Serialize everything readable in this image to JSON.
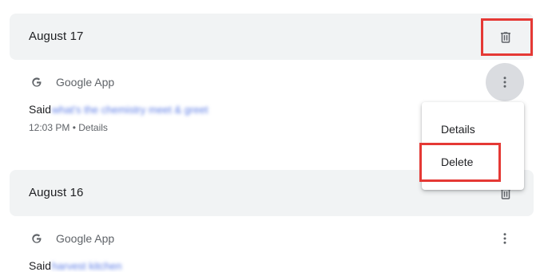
{
  "groups": [
    {
      "date": "August 17",
      "entry": {
        "app_icon": "google-g-icon",
        "app_name": "Google App",
        "said_prefix": "Said",
        "said_text_blurred": "what's the chemistry meet & greet",
        "meta": "12:03 PM • Details"
      }
    },
    {
      "date": "August 16",
      "entry": {
        "app_icon": "google-g-icon",
        "app_name": "Google App",
        "said_prefix": "Said",
        "said_text_blurred": "harvest kitchen"
      }
    }
  ],
  "context_menu": {
    "items": [
      {
        "label": "Details"
      },
      {
        "label": "Delete"
      }
    ]
  },
  "colors": {
    "header_bg": "#f1f3f4",
    "highlight": "#e53935",
    "icon_gray": "#5f6368"
  }
}
